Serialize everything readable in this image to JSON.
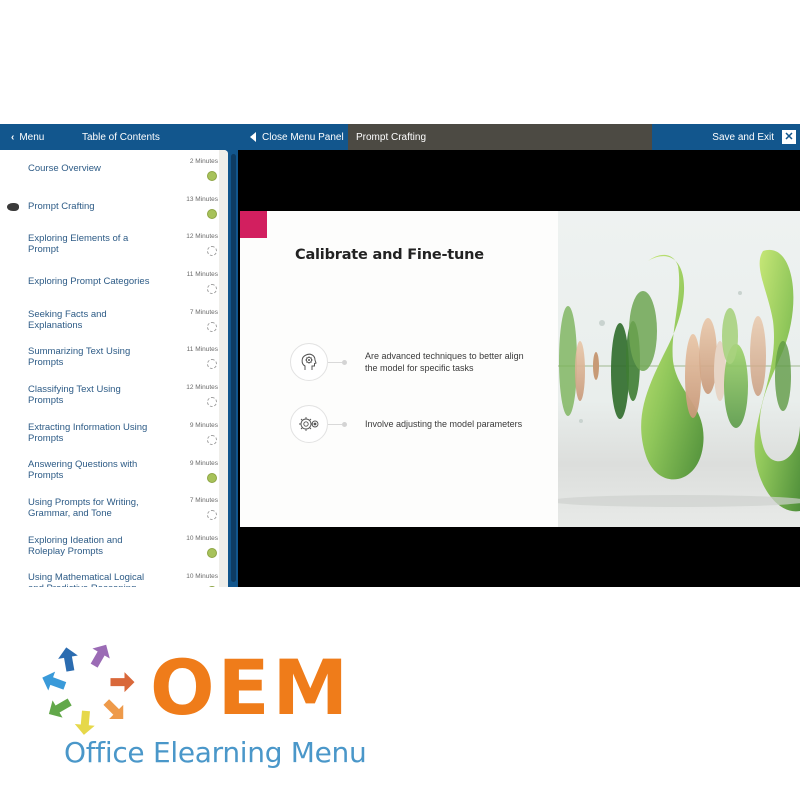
{
  "topbar": {
    "menu_label": "Menu",
    "toc_label": "Table of Contents",
    "close_panel_label": "Close Menu Panel",
    "current_title": "Prompt Crafting",
    "save_exit_label": "Save and Exit",
    "close_symbol": "✕"
  },
  "toc": {
    "items": [
      {
        "label": "Course Overview",
        "duration": "2 Minutes",
        "status": "complete",
        "current": false
      },
      {
        "label": "Prompt Crafting",
        "duration": "13 Minutes",
        "status": "complete",
        "current": true
      },
      {
        "label": "Exploring Elements of a Prompt",
        "duration": "12 Minutes",
        "status": "not-started",
        "current": false
      },
      {
        "label": "Exploring Prompt Categories",
        "duration": "11 Minutes",
        "status": "not-started",
        "current": false
      },
      {
        "label": "Seeking Facts and Explanations",
        "duration": "7 Minutes",
        "status": "not-started",
        "current": false
      },
      {
        "label": "Summarizing Text Using Prompts",
        "duration": "11 Minutes",
        "status": "not-started",
        "current": false
      },
      {
        "label": "Classifying Text Using Prompts",
        "duration": "12 Minutes",
        "status": "not-started",
        "current": false
      },
      {
        "label": "Extracting Information Using Prompts",
        "duration": "9 Minutes",
        "status": "not-started",
        "current": false
      },
      {
        "label": "Answering Questions with Prompts",
        "duration": "9 Minutes",
        "status": "complete",
        "current": false
      },
      {
        "label": "Using Prompts for Writing, Grammar, and Tone",
        "duration": "7 Minutes",
        "status": "not-started",
        "current": false
      },
      {
        "label": "Exploring Ideation and Roleplay Prompts",
        "duration": "10 Minutes",
        "status": "complete",
        "current": false
      },
      {
        "label": "Using Mathematical Logical and Predictive Reasoning",
        "duration": "10 Minutes",
        "status": "complete",
        "current": false
      }
    ]
  },
  "slide": {
    "title": "Calibrate and Fine-tune",
    "bullets": [
      {
        "icon": "brain-gear-icon",
        "text": "Are advanced techniques to better align the model for specific tasks"
      },
      {
        "icon": "gears-icon",
        "text": "Involve adjusting the model parameters"
      }
    ],
    "accent_color": "#d21f5f"
  },
  "logo": {
    "mark_text": "OEM",
    "subtitle": "Office Elearning Menu",
    "arrow_colors": [
      "#2b6cb0",
      "#9b6bb5",
      "#d9683a",
      "#ee9a4a",
      "#e6d84a",
      "#62a84a",
      "#3a9ad9"
    ]
  },
  "colors": {
    "brand_blue": "#12568d",
    "title_bar": "#4c4a43",
    "status_complete": "#a7c25a",
    "oem_orange": "#ef7c1a",
    "subtitle_blue": "#4a97c9"
  }
}
